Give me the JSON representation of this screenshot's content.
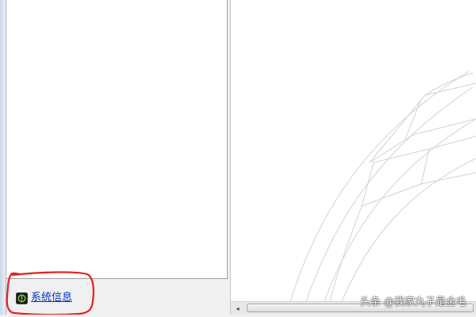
{
  "left_panel": {
    "footer": {
      "system_info_link": {
        "label": "系统信息",
        "icon": "system-info-icon"
      }
    }
  },
  "right_panel": {
    "scrollbar": {
      "left_arrow": "◂"
    }
  },
  "overlay": {
    "credit_text": "头条 @我家丸子是金毛"
  },
  "colors": {
    "link": "#0033cc",
    "annotation": "#e8201c",
    "panel_bg": "#f0f0f0",
    "icon_bg": "#1a1a1a",
    "icon_accent": "#7fd03a"
  }
}
